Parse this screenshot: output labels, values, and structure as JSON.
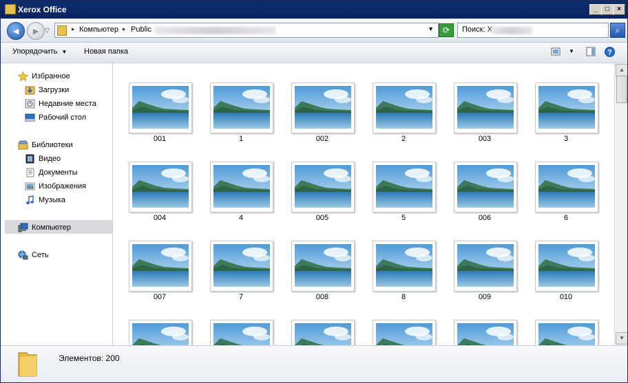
{
  "window": {
    "title": "Xerox Office",
    "minimize": "_",
    "maximize": "□",
    "close": "×"
  },
  "address": {
    "segments": [
      "Компьютер",
      "Public"
    ],
    "back_glyph": "◄",
    "forward_glyph": "►",
    "refresh_glyph": "⟳",
    "search_label": "Поиск: X",
    "search_glyph": "⌕"
  },
  "toolbar": {
    "organize_label": "Упорядочить",
    "new_folder_label": "Новая папка",
    "help_glyph": "?"
  },
  "nav": {
    "favorites": {
      "label": "Избранное",
      "items": [
        {
          "label": "Загрузки",
          "icon": "downloads-icon"
        },
        {
          "label": "Недавние места",
          "icon": "recent-places-icon"
        },
        {
          "label": "Рабочий стол",
          "icon": "desktop-icon"
        }
      ]
    },
    "libraries": {
      "label": "Библиотеки",
      "items": [
        {
          "label": "Видео",
          "icon": "video-library-icon"
        },
        {
          "label": "Документы",
          "icon": "documents-library-icon"
        },
        {
          "label": "Изображения",
          "icon": "pictures-library-icon"
        },
        {
          "label": "Музыка",
          "icon": "music-library-icon"
        }
      ]
    },
    "computer": {
      "label": "Компьютер",
      "selected": true
    },
    "network": {
      "label": "Сеть"
    }
  },
  "files": [
    {
      "name": "001"
    },
    {
      "name": "1"
    },
    {
      "name": "002"
    },
    {
      "name": "2"
    },
    {
      "name": "003"
    },
    {
      "name": "3"
    },
    {
      "name": "004"
    },
    {
      "name": "4"
    },
    {
      "name": "005"
    },
    {
      "name": "5"
    },
    {
      "name": "006"
    },
    {
      "name": "6"
    },
    {
      "name": "007"
    },
    {
      "name": "7"
    },
    {
      "name": "008"
    },
    {
      "name": "8"
    },
    {
      "name": "009"
    },
    {
      "name": "010"
    }
  ],
  "status": {
    "item_count": "Элементов: 200"
  },
  "colors": {
    "titlebar": "#0a2460",
    "accent": "#1e5aaa"
  }
}
